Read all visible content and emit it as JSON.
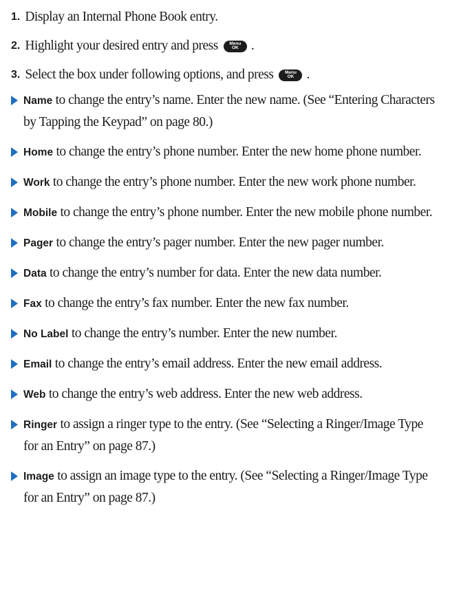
{
  "steps": [
    {
      "num": "1.",
      "text": "Display an Internal Phone Book entry."
    },
    {
      "num": "2.",
      "text": "Highlight your desired entry and press",
      "key_top": "Menu",
      "key_bottom": "OK",
      "after": "."
    },
    {
      "num": "3.",
      "text": "Select the box under following options, and press",
      "key_top": "Menu",
      "key_bottom": "OK",
      "after": "."
    }
  ],
  "bullets": [
    {
      "term": "Name",
      "text": " to change the entry’s name. Enter the new name. (See “Entering Characters by Tapping the Keypad” on page 80.)"
    },
    {
      "term": "Home",
      "text": " to change the entry’s phone number. Enter the new home phone number."
    },
    {
      "term": "Work",
      "text": " to change the entry’s phone number. Enter the new work phone number."
    },
    {
      "term": "Mobile",
      "text": " to change the entry’s phone number. Enter the new mobile phone number."
    },
    {
      "term": "Pager",
      "text": " to change the entry’s pager number. Enter the new pager number."
    },
    {
      "term": "Data",
      "text": " to change the entry’s number for data. Enter the new data number."
    },
    {
      "term": "Fax",
      "text": " to change the entry’s fax number. Enter the new fax number."
    },
    {
      "term": "No Label",
      "text": " to change the entry’s number. Enter the new number."
    },
    {
      "term": "Email",
      "text": " to change the entry’s email address. Enter the new email address."
    },
    {
      "term": "Web",
      "text": " to change the entry’s web address. Enter the new web address."
    },
    {
      "term": "Ringer",
      "text": " to assign a ringer type to the entry. (See “Selecting a Ringer/Image Type for an Entry” on page 87.)"
    },
    {
      "term": "Image",
      "text": " to assign an image type to the entry. (See “Selecting a Ringer/Image Type for an Entry” on page 87.)"
    }
  ],
  "colors": {
    "bullet_arrow": "#1f6fbf",
    "text": "#1c1c1c",
    "key_bg": "#1c1c1c"
  },
  "icons": {
    "bullet": "triangle-right-icon",
    "key": "menu-ok-key-icon"
  }
}
